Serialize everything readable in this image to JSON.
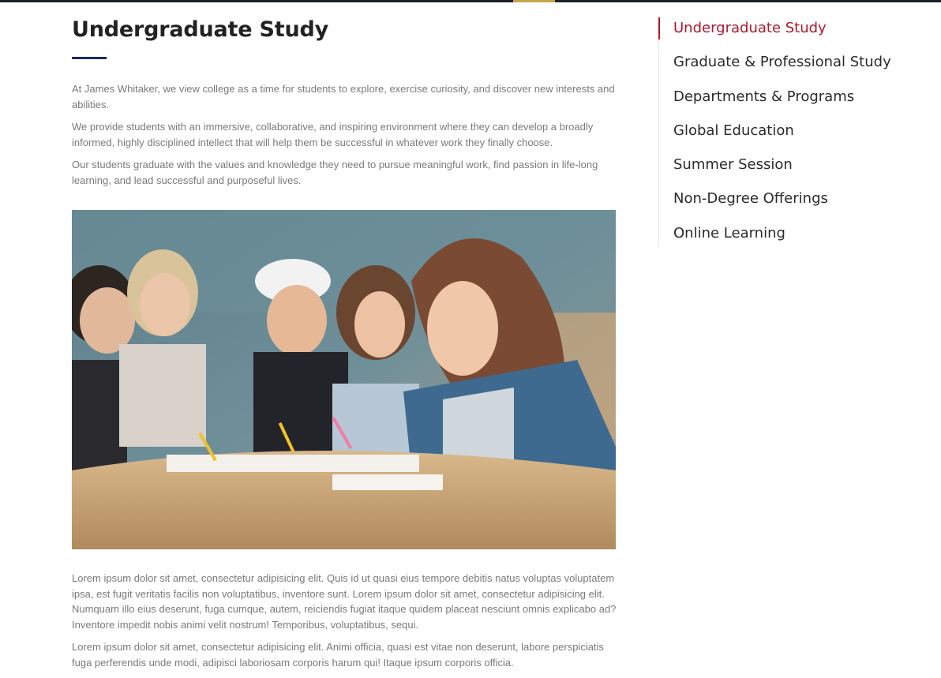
{
  "page": {
    "title": "Undergraduate Study",
    "intro": [
      "At James Whitaker, we view college as a time for students to explore, exercise curiosity, and discover new interests and abilities.",
      "We provide students with an immersive, collaborative, and inspiring environment where they can develop a broadly informed, highly disciplined intellect that will help them be successful in whatever work they finally choose.",
      "Our students graduate with the values and knowledge they need to pursue meaningful work, find passion in life-long learning, and lead successful and purposeful lives."
    ],
    "body": [
      "Lorem ipsum dolor sit amet, consectetur adipisicing elit. Quis id ut quasi eius tempore debitis natus voluptas voluptatem ipsa, est fugit veritatis facilis non voluptatibus, inventore sunt. Lorem ipsum dolor sit amet, consectetur adipisicing elit. Numquam illo eius deserunt, fuga cumque, autem, reiciendis fugiat itaque quidem placeat nesciunt omnis explicabo ad? Inventore impedit nobis animi velit nostrum! Temporibus, voluptatibus, sequi.",
      "Lorem ipsum dolor sit amet, consectetur adipisicing elit. Animi officia, quasi est vitae non deserunt, labore perspiciatis fuga perferendis unde modi, adipisci laboriosam corporis harum qui! Itaque ipsum corporis officia."
    ]
  },
  "sidebar": {
    "items": [
      {
        "label": "Undergraduate Study",
        "active": true
      },
      {
        "label": "Graduate & Professional Study"
      },
      {
        "label": "Departments & Programs"
      },
      {
        "label": "Global Education"
      },
      {
        "label": "Summer Session"
      },
      {
        "label": "Non-Degree Offerings"
      },
      {
        "label": "Online Learning"
      }
    ]
  },
  "colors": {
    "accent": "#b0182a",
    "title_underline": "#1e2a5a",
    "topbar": "#1b1f2b"
  }
}
